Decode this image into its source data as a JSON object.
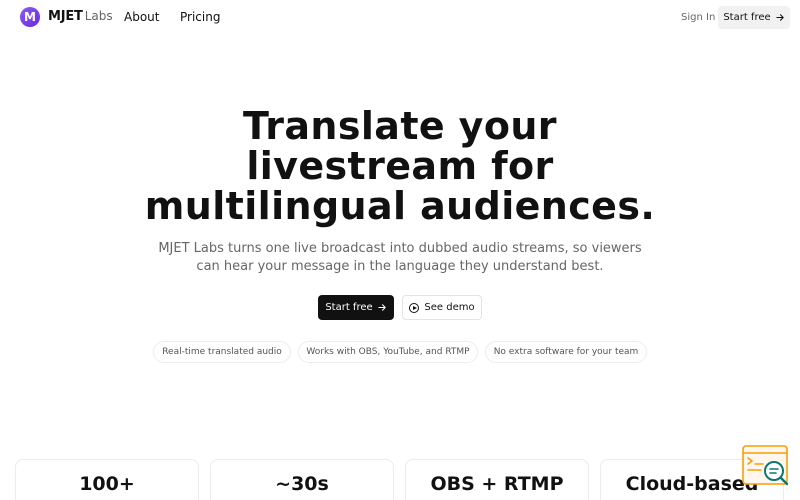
{
  "nav": {
    "logo_letter": "M",
    "brand_main": "MJET",
    "brand_sub": "Labs",
    "about": "About",
    "pricing": "Pricing",
    "sign_in": "Sign In",
    "start_free": "Start free"
  },
  "hero": {
    "title_lines": [
      "Translate your",
      "livestream for",
      "multilingual audiences."
    ],
    "subtitle_lines": [
      "MJET Labs turns one live broadcast into dubbed audio streams, so viewers",
      "can hear your message in the language they understand best."
    ],
    "primary_cta": "Start free",
    "secondary_cta": "See demo"
  },
  "pills": [
    "Real-time translated audio",
    "Works with OBS, YouTube, and RTMP",
    "No extra software for your team"
  ],
  "stats": [
    {
      "value": "100+"
    },
    {
      "value": "~30s"
    },
    {
      "value": "OBS + RTMP"
    },
    {
      "value": "Cloud-based"
    }
  ],
  "icons": {
    "arrow": "arrow-right-icon",
    "play": "play-circle-icon",
    "widget": "search-document-icon"
  },
  "colors": {
    "brand_accent": "#7c3aed",
    "primary_button": "#111111",
    "widget_accent": "#f59e0b",
    "widget_lens": "#0f766e"
  }
}
